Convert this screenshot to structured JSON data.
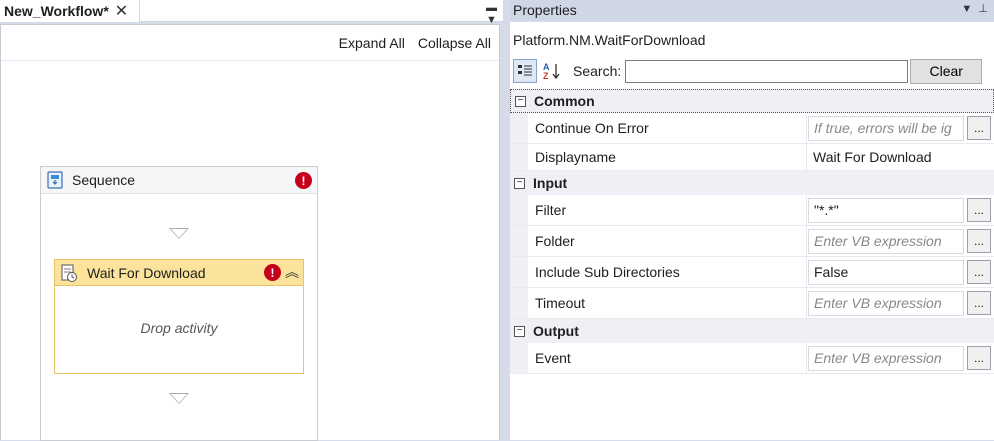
{
  "document_tab": {
    "title": "New_Workflow*",
    "close_glyph": "✕"
  },
  "designer_toolbar": {
    "expand_all": "Expand All",
    "collapse_all": "Collapse All"
  },
  "sequence": {
    "title": "Sequence",
    "error_glyph": "!"
  },
  "activity": {
    "title": "Wait For Download",
    "error_glyph": "!",
    "collapse_glyph": "︽",
    "drop_text": "Drop activity"
  },
  "properties": {
    "panel_title": "Properties",
    "type_name": "Platform.NM.WaitForDownload",
    "search_label": "Search:",
    "search_value": "",
    "clear_label": "Clear",
    "categories": [
      {
        "name": "Common",
        "toggle": "−",
        "props": [
          {
            "name": "Continue On Error",
            "value": "If true, errors will be ig",
            "placeholder": true,
            "has_button": true
          },
          {
            "name": "Displayname",
            "value": "Wait For Download",
            "placeholder": false,
            "has_button": false
          }
        ]
      },
      {
        "name": "Input",
        "toggle": "−",
        "props": [
          {
            "name": "Filter",
            "value": "\"*.*\"",
            "placeholder": false,
            "has_button": true
          },
          {
            "name": "Folder",
            "value": "Enter VB expression",
            "placeholder": true,
            "has_button": true
          },
          {
            "name": "Include Sub Directories",
            "value": "False",
            "placeholder": false,
            "has_button": true
          },
          {
            "name": "Timeout",
            "value": "Enter VB expression",
            "placeholder": true,
            "has_button": true
          }
        ]
      },
      {
        "name": "Output",
        "toggle": "−",
        "props": [
          {
            "name": "Event",
            "value": "Enter VB expression",
            "placeholder": true,
            "has_button": true
          }
        ]
      }
    ],
    "ellipsis_label": "..."
  },
  "colors": {
    "accent_yellow": "#fbe39b",
    "error_red": "#c6001c",
    "panel_bg": "#d6dbe9"
  },
  "icons": [
    "sequence-icon",
    "wait-for-download-icon",
    "error-icon",
    "collapse-icon",
    "categorized-icon",
    "alphabetical-icon",
    "tab-dropdown-icon",
    "pin-icon"
  ]
}
